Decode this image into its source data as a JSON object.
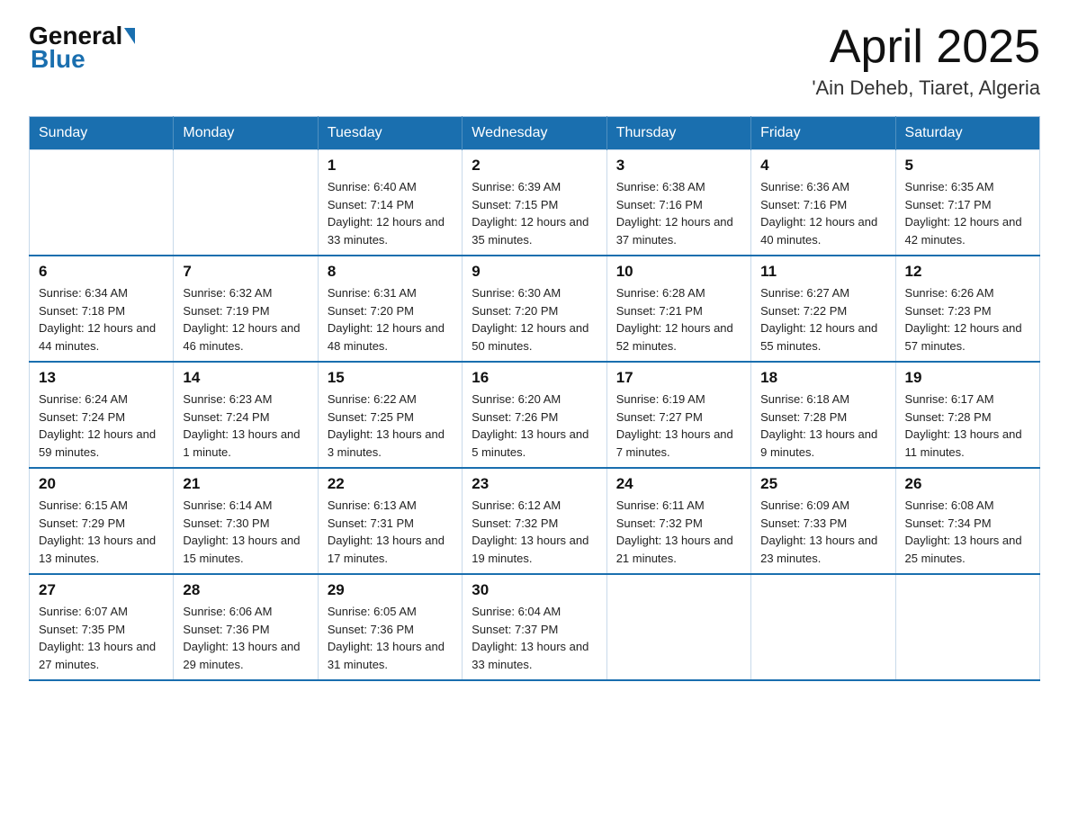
{
  "logo": {
    "general": "General",
    "blue": "Blue"
  },
  "title": "April 2025",
  "subtitle": "'Ain Deheb, Tiaret, Algeria",
  "weekdays": [
    "Sunday",
    "Monday",
    "Tuesday",
    "Wednesday",
    "Thursday",
    "Friday",
    "Saturday"
  ],
  "weeks": [
    [
      {
        "day": "",
        "sunrise": "",
        "sunset": "",
        "daylight": ""
      },
      {
        "day": "",
        "sunrise": "",
        "sunset": "",
        "daylight": ""
      },
      {
        "day": "1",
        "sunrise": "Sunrise: 6:40 AM",
        "sunset": "Sunset: 7:14 PM",
        "daylight": "Daylight: 12 hours and 33 minutes."
      },
      {
        "day": "2",
        "sunrise": "Sunrise: 6:39 AM",
        "sunset": "Sunset: 7:15 PM",
        "daylight": "Daylight: 12 hours and 35 minutes."
      },
      {
        "day": "3",
        "sunrise": "Sunrise: 6:38 AM",
        "sunset": "Sunset: 7:16 PM",
        "daylight": "Daylight: 12 hours and 37 minutes."
      },
      {
        "day": "4",
        "sunrise": "Sunrise: 6:36 AM",
        "sunset": "Sunset: 7:16 PM",
        "daylight": "Daylight: 12 hours and 40 minutes."
      },
      {
        "day": "5",
        "sunrise": "Sunrise: 6:35 AM",
        "sunset": "Sunset: 7:17 PM",
        "daylight": "Daylight: 12 hours and 42 minutes."
      }
    ],
    [
      {
        "day": "6",
        "sunrise": "Sunrise: 6:34 AM",
        "sunset": "Sunset: 7:18 PM",
        "daylight": "Daylight: 12 hours and 44 minutes."
      },
      {
        "day": "7",
        "sunrise": "Sunrise: 6:32 AM",
        "sunset": "Sunset: 7:19 PM",
        "daylight": "Daylight: 12 hours and 46 minutes."
      },
      {
        "day": "8",
        "sunrise": "Sunrise: 6:31 AM",
        "sunset": "Sunset: 7:20 PM",
        "daylight": "Daylight: 12 hours and 48 minutes."
      },
      {
        "day": "9",
        "sunrise": "Sunrise: 6:30 AM",
        "sunset": "Sunset: 7:20 PM",
        "daylight": "Daylight: 12 hours and 50 minutes."
      },
      {
        "day": "10",
        "sunrise": "Sunrise: 6:28 AM",
        "sunset": "Sunset: 7:21 PM",
        "daylight": "Daylight: 12 hours and 52 minutes."
      },
      {
        "day": "11",
        "sunrise": "Sunrise: 6:27 AM",
        "sunset": "Sunset: 7:22 PM",
        "daylight": "Daylight: 12 hours and 55 minutes."
      },
      {
        "day": "12",
        "sunrise": "Sunrise: 6:26 AM",
        "sunset": "Sunset: 7:23 PM",
        "daylight": "Daylight: 12 hours and 57 minutes."
      }
    ],
    [
      {
        "day": "13",
        "sunrise": "Sunrise: 6:24 AM",
        "sunset": "Sunset: 7:24 PM",
        "daylight": "Daylight: 12 hours and 59 minutes."
      },
      {
        "day": "14",
        "sunrise": "Sunrise: 6:23 AM",
        "sunset": "Sunset: 7:24 PM",
        "daylight": "Daylight: 13 hours and 1 minute."
      },
      {
        "day": "15",
        "sunrise": "Sunrise: 6:22 AM",
        "sunset": "Sunset: 7:25 PM",
        "daylight": "Daylight: 13 hours and 3 minutes."
      },
      {
        "day": "16",
        "sunrise": "Sunrise: 6:20 AM",
        "sunset": "Sunset: 7:26 PM",
        "daylight": "Daylight: 13 hours and 5 minutes."
      },
      {
        "day": "17",
        "sunrise": "Sunrise: 6:19 AM",
        "sunset": "Sunset: 7:27 PM",
        "daylight": "Daylight: 13 hours and 7 minutes."
      },
      {
        "day": "18",
        "sunrise": "Sunrise: 6:18 AM",
        "sunset": "Sunset: 7:28 PM",
        "daylight": "Daylight: 13 hours and 9 minutes."
      },
      {
        "day": "19",
        "sunrise": "Sunrise: 6:17 AM",
        "sunset": "Sunset: 7:28 PM",
        "daylight": "Daylight: 13 hours and 11 minutes."
      }
    ],
    [
      {
        "day": "20",
        "sunrise": "Sunrise: 6:15 AM",
        "sunset": "Sunset: 7:29 PM",
        "daylight": "Daylight: 13 hours and 13 minutes."
      },
      {
        "day": "21",
        "sunrise": "Sunrise: 6:14 AM",
        "sunset": "Sunset: 7:30 PM",
        "daylight": "Daylight: 13 hours and 15 minutes."
      },
      {
        "day": "22",
        "sunrise": "Sunrise: 6:13 AM",
        "sunset": "Sunset: 7:31 PM",
        "daylight": "Daylight: 13 hours and 17 minutes."
      },
      {
        "day": "23",
        "sunrise": "Sunrise: 6:12 AM",
        "sunset": "Sunset: 7:32 PM",
        "daylight": "Daylight: 13 hours and 19 minutes."
      },
      {
        "day": "24",
        "sunrise": "Sunrise: 6:11 AM",
        "sunset": "Sunset: 7:32 PM",
        "daylight": "Daylight: 13 hours and 21 minutes."
      },
      {
        "day": "25",
        "sunrise": "Sunrise: 6:09 AM",
        "sunset": "Sunset: 7:33 PM",
        "daylight": "Daylight: 13 hours and 23 minutes."
      },
      {
        "day": "26",
        "sunrise": "Sunrise: 6:08 AM",
        "sunset": "Sunset: 7:34 PM",
        "daylight": "Daylight: 13 hours and 25 minutes."
      }
    ],
    [
      {
        "day": "27",
        "sunrise": "Sunrise: 6:07 AM",
        "sunset": "Sunset: 7:35 PM",
        "daylight": "Daylight: 13 hours and 27 minutes."
      },
      {
        "day": "28",
        "sunrise": "Sunrise: 6:06 AM",
        "sunset": "Sunset: 7:36 PM",
        "daylight": "Daylight: 13 hours and 29 minutes."
      },
      {
        "day": "29",
        "sunrise": "Sunrise: 6:05 AM",
        "sunset": "Sunset: 7:36 PM",
        "daylight": "Daylight: 13 hours and 31 minutes."
      },
      {
        "day": "30",
        "sunrise": "Sunrise: 6:04 AM",
        "sunset": "Sunset: 7:37 PM",
        "daylight": "Daylight: 13 hours and 33 minutes."
      },
      {
        "day": "",
        "sunrise": "",
        "sunset": "",
        "daylight": ""
      },
      {
        "day": "",
        "sunrise": "",
        "sunset": "",
        "daylight": ""
      },
      {
        "day": "",
        "sunrise": "",
        "sunset": "",
        "daylight": ""
      }
    ]
  ]
}
